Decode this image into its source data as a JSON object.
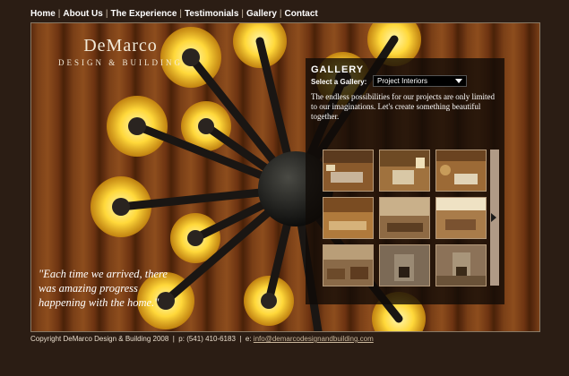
{
  "nav": {
    "items": [
      "Home",
      "About Us",
      "The Experience",
      "Testimonials",
      "Gallery",
      "Contact"
    ],
    "separator": "|"
  },
  "logo": {
    "line1": "DeMarco",
    "line2": "DESIGN & BUILDING"
  },
  "quote": "\"Each time we arrived, there was amazing progress happening with the home.\"",
  "gallery": {
    "title": "GALLERY",
    "select_label": "Select a Gallery:",
    "selected": "Project Interiors",
    "description": "The endless possibilities for our projects are only limited to our imaginations. Let's create something beautiful together.",
    "thumbnails": [
      "kitchen-photo",
      "kitchen-photo",
      "kitchen-photo",
      "kitchen-photo",
      "living-room-photo",
      "kitchen-photo",
      "living-room-photo",
      "fireplace-photo",
      "fireplace-photo"
    ],
    "next_icon": "arrow-right-icon"
  },
  "footer": {
    "copyright": "Copyright DeMarco Design & Building 2008",
    "sep": "|",
    "phone": "p: (541) 410-6183",
    "email_prefix": "e:",
    "email": "info@demarcodesignandbuilding.com"
  },
  "colors": {
    "background": "#2b1d14",
    "wood": "#7a3f17",
    "bulb": "#ffd83a",
    "panel": "#0f0a06"
  }
}
